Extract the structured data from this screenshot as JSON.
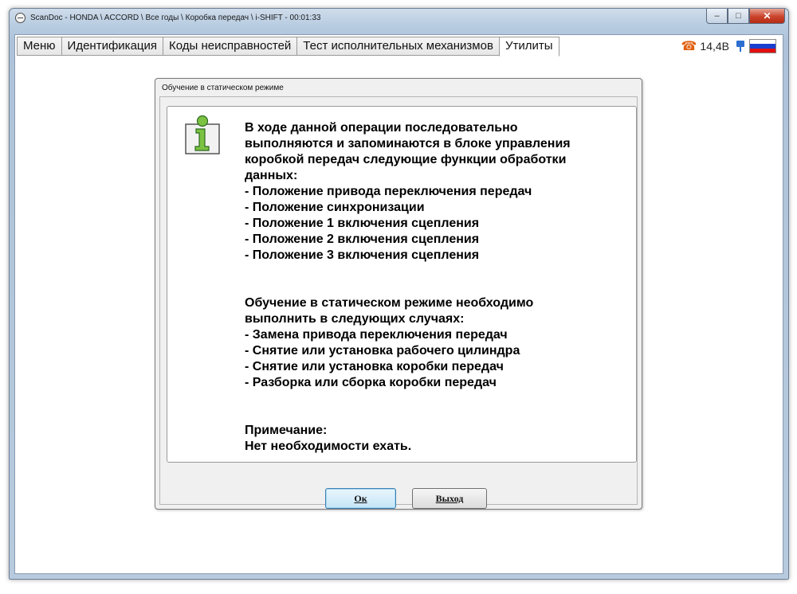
{
  "window": {
    "title": "ScanDoc - HONDA \\ ACCORD \\ Все годы \\ Коробка передач \\ i-SHIFT - 00:01:33",
    "controls": {
      "minimize": "–",
      "maximize": "□",
      "close": "✕"
    }
  },
  "tabs": [
    {
      "label": "Меню",
      "active": false
    },
    {
      "label": "Идентификация",
      "active": false
    },
    {
      "label": "Коды неисправностей",
      "active": false
    },
    {
      "label": "Тест исполнительных механизмов",
      "active": false
    },
    {
      "label": "Утилиты",
      "active": true
    }
  ],
  "status": {
    "voltage": "14,4В",
    "icons": [
      "phone-icon",
      "plug-icon",
      "russia-flag-icon"
    ],
    "flag_colors": [
      "#ffffff",
      "#1a3fcf",
      "#e01010"
    ]
  },
  "dialog": {
    "title": "Обучение в статическом режиме",
    "message": "В ходе данной операции последовательно\nвыполняются и запоминаются в блоке управления\nкоробкой передач следующие функции обработки\nданных:\n- Положение привода переключения передач\n- Положение синхронизации\n- Положение 1 включения сцепления\n- Положение 2 включения сцепления\n- Положение 3 включения сцепления\n\n\nОбучение в статическом режиме необходимо\nвыполнить в следующих случаях:\n- Замена привода переключения передач\n- Снятие или установка рабочего цилиндра\n- Снятие или установка коробки передач\n- Разборка или сборка коробки передач\n\n\nПримечание:\nНет необходимости ехать.",
    "ok_label": "Ок",
    "exit_label": "Выход"
  }
}
